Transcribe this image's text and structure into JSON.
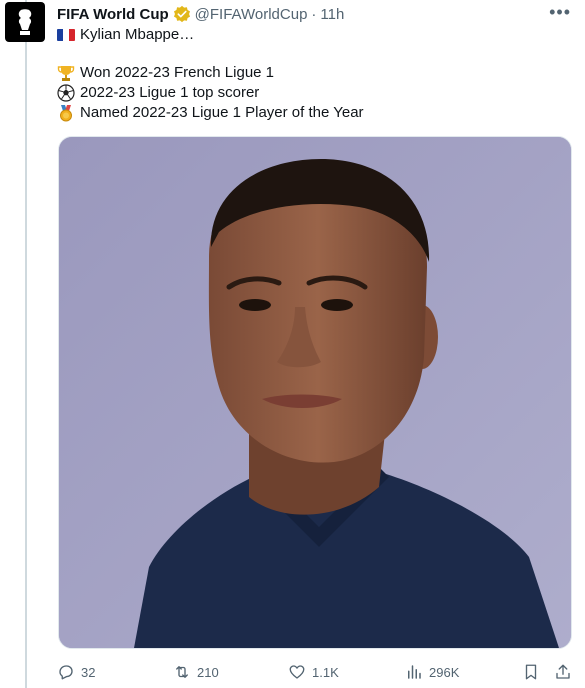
{
  "tweet": {
    "author_name": "FIFA World Cup",
    "handle": "@FIFAWorldCup",
    "separator": "·",
    "time": "11h",
    "subtitle": "Kylian Mbappe…",
    "lines": [
      {
        "icon": "trophy-icon",
        "text": "Won 2022-23 French Ligue 1"
      },
      {
        "icon": "soccer-ball-icon",
        "text": "2022-23 Ligue 1 top scorer"
      },
      {
        "icon": "medal-icon",
        "text": "Named 2022-23 Ligue 1 Player of the Year"
      }
    ],
    "more_icon": "more-icon",
    "actions": {
      "replies": "32",
      "retweets": "210",
      "likes": "1.1K",
      "views": "296K"
    },
    "colors": {
      "verified_gold": "#e2b719",
      "muted": "#536471",
      "photo_background": "#a2a0c3",
      "jersey": "#1c2a4a"
    }
  }
}
